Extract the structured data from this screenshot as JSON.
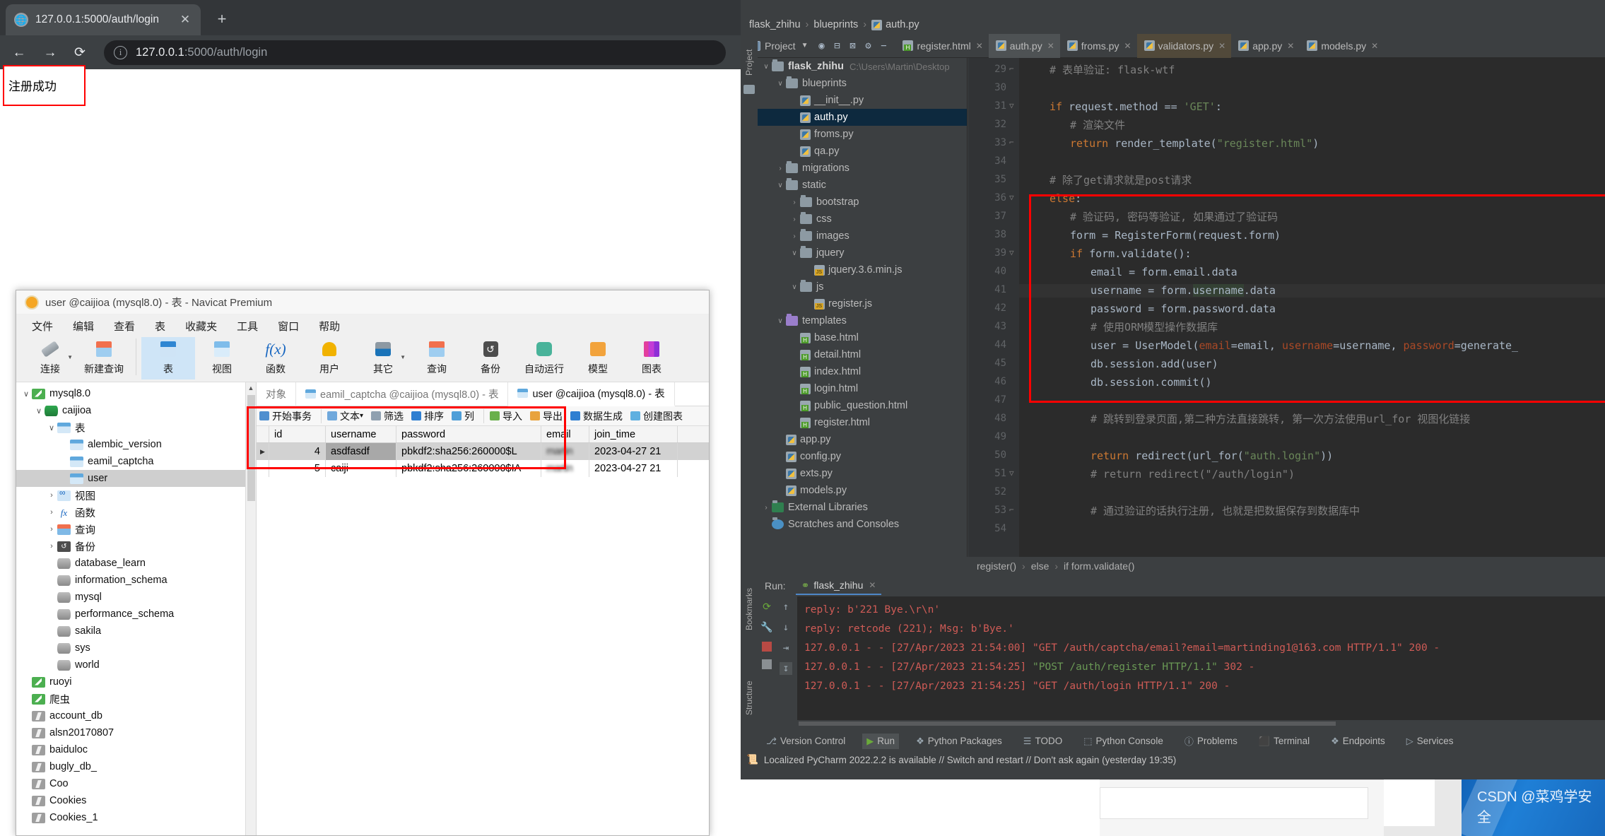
{
  "browser": {
    "tab": {
      "title": "127.0.0.1:5000/auth/login",
      "favicon_icon": "globe-icon",
      "close_icon": "close-icon"
    },
    "new_tab_icon": "plus-icon",
    "nav": {
      "back_icon": "arrow-left-icon",
      "forward_icon": "arrow-right-icon",
      "reload_icon": "reload-icon"
    },
    "omnibox": {
      "info_icon": "info-circle-icon",
      "url_host": "127.0.0.1",
      "url_rest": ":5000/auth/login"
    },
    "page": {
      "flash_message": "注册成功"
    }
  },
  "navicat": {
    "title": "user @caijioa (mysql8.0) - 表 - Navicat Premium",
    "logo_icon": "navicat-logo-icon",
    "menus": [
      "文件",
      "编辑",
      "查看",
      "表",
      "收藏夹",
      "工具",
      "窗口",
      "帮助"
    ],
    "toolbar": [
      {
        "label": "连接",
        "icon": "connection-icon",
        "caret": true,
        "selected": false
      },
      {
        "label": "新建查询",
        "icon": "new-query-icon",
        "caret": false,
        "selected": false
      },
      {
        "sep": true
      },
      {
        "label": "表",
        "icon": "table-icon",
        "caret": false,
        "selected": true
      },
      {
        "label": "视图",
        "icon": "view-icon",
        "caret": false,
        "selected": false
      },
      {
        "label": "函数",
        "icon": "function-icon",
        "caret": false,
        "selected": false
      },
      {
        "label": "用户",
        "icon": "user-icon",
        "caret": false,
        "selected": false
      },
      {
        "label": "其它",
        "icon": "other-tools-icon",
        "caret": true,
        "selected": false
      },
      {
        "label": "查询",
        "icon": "query-icon",
        "caret": false,
        "selected": false
      },
      {
        "label": "备份",
        "icon": "backup-icon",
        "caret": false,
        "selected": false
      },
      {
        "label": "自动运行",
        "icon": "automation-icon",
        "caret": false,
        "selected": false
      },
      {
        "label": "模型",
        "icon": "model-icon",
        "caret": false,
        "selected": false
      },
      {
        "label": "图表",
        "icon": "chart-icon",
        "caret": false,
        "selected": false
      }
    ],
    "tree": [
      {
        "label": "mysql8.0",
        "depth": 0,
        "icon": "mysql-connection-icon",
        "twisty": "down",
        "selected": false
      },
      {
        "label": "caijioa",
        "depth": 1,
        "icon": "database-icon",
        "twisty": "down",
        "selected": false
      },
      {
        "label": "表",
        "depth": 2,
        "icon": "table-folder-icon",
        "twisty": "down",
        "selected": false
      },
      {
        "label": "alembic_version",
        "depth": 3,
        "icon": "table-icon",
        "twisty": "",
        "selected": false
      },
      {
        "label": "eamil_captcha",
        "depth": 3,
        "icon": "table-icon",
        "twisty": "",
        "selected": false
      },
      {
        "label": "user",
        "depth": 3,
        "icon": "table-icon",
        "twisty": "",
        "selected": true
      },
      {
        "label": "视图",
        "depth": 2,
        "icon": "view-icon",
        "twisty": "right",
        "selected": false
      },
      {
        "label": "函数",
        "depth": 2,
        "icon": "function-icon",
        "twisty": "right",
        "selected": false
      },
      {
        "label": "查询",
        "depth": 2,
        "icon": "query-icon",
        "twisty": "right",
        "selected": false
      },
      {
        "label": "备份",
        "depth": 2,
        "icon": "backup-icon",
        "twisty": "right",
        "selected": false
      },
      {
        "label": "database_learn",
        "depth": 2,
        "icon": "database-grey-icon",
        "twisty": "",
        "selected": false
      },
      {
        "label": "information_schema",
        "depth": 2,
        "icon": "database-grey-icon",
        "twisty": "",
        "selected": false
      },
      {
        "label": "mysql",
        "depth": 2,
        "icon": "database-grey-icon",
        "twisty": "",
        "selected": false
      },
      {
        "label": "performance_schema",
        "depth": 2,
        "icon": "database-grey-icon",
        "twisty": "",
        "selected": false
      },
      {
        "label": "sakila",
        "depth": 2,
        "icon": "database-grey-icon",
        "twisty": "",
        "selected": false
      },
      {
        "label": "sys",
        "depth": 2,
        "icon": "database-grey-icon",
        "twisty": "",
        "selected": false
      },
      {
        "label": "world",
        "depth": 2,
        "icon": "database-grey-icon",
        "twisty": "",
        "selected": false
      },
      {
        "label": "ruoyi",
        "depth": 0,
        "icon": "mysql-connection-icon",
        "twisty": "",
        "selected": false
      },
      {
        "label": "爬虫",
        "depth": 0,
        "icon": "mysql-connection-icon",
        "twisty": "",
        "selected": false
      },
      {
        "label": "account_db",
        "depth": 0,
        "icon": "mongodb-icon",
        "twisty": "",
        "selected": false
      },
      {
        "label": "alsn20170807",
        "depth": 0,
        "icon": "mongodb-icon",
        "twisty": "",
        "selected": false
      },
      {
        "label": "baiduloc",
        "depth": 0,
        "icon": "mongodb-icon",
        "twisty": "",
        "selected": false
      },
      {
        "label": "bugly_db_",
        "depth": 0,
        "icon": "mongodb-icon",
        "twisty": "",
        "selected": false
      },
      {
        "label": "Coo",
        "depth": 0,
        "icon": "mongodb-icon",
        "twisty": "",
        "selected": false
      },
      {
        "label": "Cookies",
        "depth": 0,
        "icon": "mongodb-icon",
        "twisty": "",
        "selected": false
      },
      {
        "label": "Cookies_1",
        "depth": 0,
        "icon": "mongodb-icon",
        "twisty": "",
        "selected": false
      }
    ],
    "object_tabs": [
      {
        "label": "对象",
        "active": false,
        "icon": ""
      },
      {
        "label": "eamil_captcha @caijioa (mysql8.0) - 表",
        "active": false,
        "icon": "table-icon"
      },
      {
        "label": "user @caijioa (mysql8.0) - 表",
        "active": true,
        "icon": "table-icon"
      }
    ],
    "grid_toolbar": [
      {
        "label": "开始事务",
        "icon": "transaction-icon"
      },
      {
        "sep": true
      },
      {
        "label": "文本",
        "icon": "text-icon",
        "caret": true
      },
      {
        "label": "筛选",
        "icon": "filter-icon"
      },
      {
        "label": "排序",
        "icon": "sort-icon"
      },
      {
        "label": "列",
        "icon": "columns-icon"
      },
      {
        "sep": true
      },
      {
        "label": "导入",
        "icon": "import-icon"
      },
      {
        "label": "导出",
        "icon": "export-icon"
      },
      {
        "label": "数据生成",
        "icon": "data-generation-icon"
      },
      {
        "label": "创建图表",
        "icon": "create-chart-icon"
      }
    ],
    "grid": {
      "columns": [
        "id",
        "username",
        "password",
        "email",
        "join_time"
      ],
      "rows": [
        {
          "marker": "▶",
          "id": "4",
          "username": "asdfasdf",
          "password": "pbkdf2:sha256:260000$L",
          "email": "martin",
          "join_time": "2023-04-27 21"
        },
        {
          "marker": "",
          "id": "5",
          "username": "caiji",
          "password": "pbkdf2:sha256:260000$IA",
          "email": "martin",
          "join_time": "2023-04-27 21"
        }
      ]
    }
  },
  "pycharm": {
    "breadcrumb": {
      "project": "flask_zhihu",
      "folder": "blueprints",
      "file": "auth.py",
      "file_icon": "python-file-icon"
    },
    "project_button": {
      "label": "Project",
      "icon": "project-panel-icon",
      "caret_icon": "chevron-down-icon"
    },
    "toolbar_icons": [
      "target-icon",
      "collapse-all-icon",
      "expand-all-icon",
      "settings-gear-icon",
      "hide-minus-icon"
    ],
    "editor_tabs": [
      {
        "label": "register.html",
        "icon": "html-file-icon",
        "state": "normal"
      },
      {
        "label": "auth.py",
        "icon": "python-file-icon",
        "state": "active"
      },
      {
        "label": "froms.py",
        "icon": "python-file-icon",
        "state": "normal"
      },
      {
        "label": "validators.py",
        "icon": "python-file-icon",
        "state": "modified"
      },
      {
        "label": "app.py",
        "icon": "python-file-icon",
        "state": "normal"
      },
      {
        "label": "models.py",
        "icon": "python-file-icon",
        "state": "normal"
      }
    ],
    "side_strip_label": "Project",
    "bookmarks_strip_label": "Bookmarks",
    "structure_strip_label": "Structure",
    "project_tree": [
      {
        "label": "flask_zhihu",
        "path": "C:\\Users\\Martin\\Desktop",
        "depth": 0,
        "icon": "folder-icon",
        "twisty": "down",
        "bold": true,
        "selected": false
      },
      {
        "label": "blueprints",
        "depth": 1,
        "icon": "module-folder-icon",
        "twisty": "down",
        "selected": false
      },
      {
        "label": "__init__.py",
        "depth": 2,
        "icon": "python-file-icon",
        "twisty": "",
        "selected": false
      },
      {
        "label": "auth.py",
        "depth": 2,
        "icon": "python-file-icon",
        "twisty": "",
        "selected": true
      },
      {
        "label": "froms.py",
        "depth": 2,
        "icon": "python-file-icon",
        "twisty": "",
        "selected": false
      },
      {
        "label": "qa.py",
        "depth": 2,
        "icon": "python-file-icon",
        "twisty": "",
        "selected": false
      },
      {
        "label": "migrations",
        "depth": 1,
        "icon": "folder-icon",
        "twisty": "right",
        "selected": false
      },
      {
        "label": "static",
        "depth": 1,
        "icon": "folder-icon",
        "twisty": "down",
        "selected": false
      },
      {
        "label": "bootstrap",
        "depth": 2,
        "icon": "folder-icon",
        "twisty": "right",
        "selected": false
      },
      {
        "label": "css",
        "depth": 2,
        "icon": "folder-icon",
        "twisty": "right",
        "selected": false
      },
      {
        "label": "images",
        "depth": 2,
        "icon": "folder-icon",
        "twisty": "right",
        "selected": false
      },
      {
        "label": "jquery",
        "depth": 2,
        "icon": "folder-icon",
        "twisty": "down",
        "selected": false
      },
      {
        "label": "jquery.3.6.min.js",
        "depth": 3,
        "icon": "js-file-icon",
        "twisty": "",
        "selected": false
      },
      {
        "label": "js",
        "depth": 2,
        "icon": "folder-icon",
        "twisty": "down",
        "selected": false
      },
      {
        "label": "register.js",
        "depth": 3,
        "icon": "js-file-icon",
        "twisty": "",
        "selected": false
      },
      {
        "label": "templates",
        "depth": 1,
        "icon": "templates-folder-icon",
        "twisty": "down",
        "selected": false
      },
      {
        "label": "base.html",
        "depth": 2,
        "icon": "html-file-icon",
        "twisty": "",
        "selected": false
      },
      {
        "label": "detail.html",
        "depth": 2,
        "icon": "html-file-icon",
        "twisty": "",
        "selected": false
      },
      {
        "label": "index.html",
        "depth": 2,
        "icon": "html-file-icon",
        "twisty": "",
        "selected": false
      },
      {
        "label": "login.html",
        "depth": 2,
        "icon": "html-file-icon",
        "twisty": "",
        "selected": false
      },
      {
        "label": "public_question.html",
        "depth": 2,
        "icon": "html-file-icon",
        "twisty": "",
        "selected": false
      },
      {
        "label": "register.html",
        "depth": 2,
        "icon": "html-file-icon",
        "twisty": "",
        "selected": false
      },
      {
        "label": "app.py",
        "depth": 1,
        "icon": "python-file-icon",
        "twisty": "",
        "selected": false
      },
      {
        "label": "config.py",
        "depth": 1,
        "icon": "python-file-icon",
        "twisty": "",
        "selected": false
      },
      {
        "label": "exts.py",
        "depth": 1,
        "icon": "python-file-icon",
        "twisty": "",
        "selected": false
      },
      {
        "label": "models.py",
        "depth": 1,
        "icon": "python-file-icon",
        "twisty": "",
        "selected": false
      },
      {
        "label": "External Libraries",
        "depth": 0,
        "icon": "libraries-icon",
        "twisty": "right",
        "selected": false
      },
      {
        "label": "Scratches and Consoles",
        "depth": 0,
        "icon": "scratches-icon",
        "twisty": "",
        "selected": false
      }
    ],
    "editor": {
      "first_line_number": 29,
      "lines": [
        {
          "n": 29,
          "indent": 1,
          "html": "<span class=\"cm\"># 表单验证: flask-wtf</span>",
          "fold": "end"
        },
        {
          "n": 30,
          "indent": 0,
          "html": ""
        },
        {
          "n": 31,
          "indent": 1,
          "html": "<span class=\"kw\">if</span> request.method == <span class=\"str\">'GET'</span>:",
          "fold": "start"
        },
        {
          "n": 32,
          "indent": 2,
          "html": "<span class=\"cm\"># 渲染文件</span>"
        },
        {
          "n": 33,
          "indent": 2,
          "html": "<span class=\"kw\">return</span> render_template(<span class=\"str\">\"register.html\"</span>)",
          "fold": "end"
        },
        {
          "n": 34,
          "indent": 0,
          "html": ""
        },
        {
          "n": 35,
          "indent": 1,
          "html": "<span class=\"cm\"># 除了get请求就是post请求</span>"
        },
        {
          "n": 36,
          "indent": 1,
          "html": "<span class=\"kw\">else</span>:",
          "fold": "start"
        },
        {
          "n": 37,
          "indent": 2,
          "html": "<span class=\"cm\"># 验证码, 密码等验证, 如果通过了验证码</span>"
        },
        {
          "n": 38,
          "indent": 2,
          "html": "form = RegisterForm(request.form)"
        },
        {
          "n": 39,
          "indent": 2,
          "html": "<span class=\"kw\">if</span> form.validate():",
          "fold": "start"
        },
        {
          "n": 40,
          "indent": 3,
          "html": "email = form.email.data"
        },
        {
          "n": 41,
          "indent": 3,
          "html": "username = form.<span class=\"sel-word\">username</span>.data",
          "hl": true
        },
        {
          "n": 42,
          "indent": 3,
          "html": "password = form.password.data"
        },
        {
          "n": 43,
          "indent": 3,
          "html": "<span class=\"cm\"># 使用ORM模型操作数据库</span>"
        },
        {
          "n": 44,
          "indent": 3,
          "html": "user = UserModel(<span class=\"par\">email</span>=email, <span class=\"par\">username</span>=username, <span class=\"par\">password</span>=generate_"
        },
        {
          "n": 45,
          "indent": 3,
          "html": "db.session.add(user)"
        },
        {
          "n": 46,
          "indent": 3,
          "html": "db.session.commit()"
        },
        {
          "n": 47,
          "indent": 0,
          "html": ""
        },
        {
          "n": 48,
          "indent": 3,
          "html": "<span class=\"cm\"># 跳转到登录页面,第二种方法直接跳转, 第一次方法使用url_for 视图化链接</span>"
        },
        {
          "n": 49,
          "indent": 0,
          "html": ""
        },
        {
          "n": 50,
          "indent": 3,
          "html": "<span class=\"kw\">return</span> redirect(url_for(<span class=\"str\">\"auth.login\"</span>))"
        },
        {
          "n": 51,
          "indent": 3,
          "html": "<span class=\"cm\"># return redirect(\"/auth/login\")</span>",
          "fold": "start"
        },
        {
          "n": 52,
          "indent": 0,
          "html": ""
        },
        {
          "n": 53,
          "indent": 3,
          "html": "<span class=\"cm\"># 通过验证的话执行注册, 也就是把数据保存到数据库中</span>",
          "fold": "end"
        },
        {
          "n": 54,
          "indent": 0,
          "html": ""
        }
      ]
    },
    "editor_breadcrumbs": [
      "register()",
      "else",
      "if form.validate()"
    ],
    "run_panel": {
      "label": "Run:",
      "tab_label": "flask_zhihu",
      "tab_icon": "python-run-icon",
      "close_icon": "close-icon",
      "side_icons": [
        "rerun-icon",
        "wrench-icon",
        "stop-icon"
      ],
      "side_icons2": [
        "up-arrow-icon",
        "down-arrow-icon",
        "soft-wrap-icon",
        "scroll-to-end-icon"
      ],
      "console_lines": [
        {
          "text": "reply: b'221 Bye.\\r\\n'",
          "color": "red"
        },
        {
          "text": "reply: retcode (221); Msg: b'Bye.'",
          "color": "red"
        },
        {
          "text": "127.0.0.1 - - [27/Apr/2023 21:54:00] \"GET /auth/captcha/email?email=martinding1@163.com HTTP/1.1\" 200 -",
          "color": "red"
        },
        {
          "pre": "127.0.0.1 - - [27/Apr/2023 21:54:25] ",
          "green": "\"POST /auth/register HTTP/1.1\"",
          "post": " 302 -",
          "color": "mixed"
        },
        {
          "text": "127.0.0.1 - - [27/Apr/2023 21:54:25] \"GET /auth/login HTTP/1.1\" 200 -",
          "color": "red"
        }
      ]
    },
    "bottom_tools": [
      {
        "label": "Version Control",
        "icon": "branch-icon",
        "active": false
      },
      {
        "label": "Run",
        "icon": "run-play-icon",
        "active": true
      },
      {
        "label": "Python Packages",
        "icon": "packages-icon",
        "active": false
      },
      {
        "label": "TODO",
        "icon": "todo-list-icon",
        "active": false
      },
      {
        "label": "Python Console",
        "icon": "python-console-icon",
        "active": false
      },
      {
        "label": "Problems",
        "icon": "problems-icon",
        "active": false
      },
      {
        "label": "Terminal",
        "icon": "terminal-icon",
        "active": false
      },
      {
        "label": "Endpoints",
        "icon": "endpoints-icon",
        "active": false
      },
      {
        "label": "Services",
        "icon": "services-icon",
        "active": false
      }
    ],
    "status_bar": {
      "icon": "notification-icon",
      "text": "Localized PyCharm 2022.2.2 is available // Switch and restart // Don't ask again (yesterday 19:35)"
    }
  },
  "watermark": {
    "text": "CSDN @菜鸡学安全"
  },
  "colors": {
    "accent_blue": "#2f7fd1",
    "redbox": "#ff0000",
    "pycharm_bg": "#3c3f41",
    "editor_bg": "#2b2b2b",
    "console_red": "#cf5b56",
    "console_green": "#6a9955"
  }
}
